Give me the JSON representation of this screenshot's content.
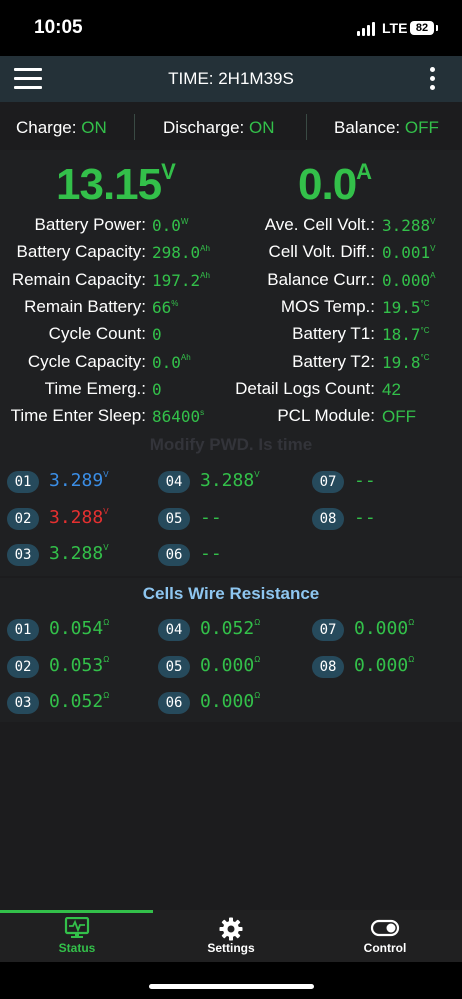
{
  "status_bar": {
    "time": "10:05",
    "network": "LTE",
    "battery": "82"
  },
  "header": {
    "title": "TIME: 2H1M39S",
    "menu_icon": "hamburger-menu-icon",
    "more_icon": "more-vertical-icon"
  },
  "toggles": [
    {
      "label": "Charge:",
      "state": "ON"
    },
    {
      "label": "Discharge:",
      "state": "ON"
    },
    {
      "label": "Balance:",
      "state": "OFF"
    }
  ],
  "summary": {
    "voltage": "13.15",
    "voltage_unit": "V",
    "current": "0.0",
    "current_unit": "A"
  },
  "left_stats": [
    {
      "label": "Battery Power:",
      "value": "0.0",
      "unit": "W"
    },
    {
      "label": "Battery Capacity:",
      "value": "298.0",
      "unit": "Ah"
    },
    {
      "label": "Remain Capacity:",
      "value": "197.2",
      "unit": "Ah"
    },
    {
      "label": "Remain Battery:",
      "value": "66",
      "unit": "%"
    },
    {
      "label": "Cycle Count:",
      "value": "0",
      "unit": ""
    },
    {
      "label": "Cycle Capacity:",
      "value": "0.0",
      "unit": "Ah"
    },
    {
      "label": "Time Emerg.:",
      "value": "0",
      "unit": ""
    },
    {
      "label": "Time Enter Sleep:",
      "value": "86400",
      "unit": "s"
    }
  ],
  "right_stats": [
    {
      "label": "Ave. Cell Volt.:",
      "value": "3.288",
      "unit": "V"
    },
    {
      "label": "Cell Volt. Diff.:",
      "value": "0.001",
      "unit": "V"
    },
    {
      "label": "Balance Curr.:",
      "value": "0.000",
      "unit": "A"
    },
    {
      "label": "MOS Temp.:",
      "value": "19.5",
      "unit": "°C"
    },
    {
      "label": "Battery T1:",
      "value": "18.7",
      "unit": "°C"
    },
    {
      "label": "Battery T2:",
      "value": "19.8",
      "unit": "°C"
    },
    {
      "label": "Detail Logs Count:",
      "value": "42",
      "unit": ""
    },
    {
      "label": "PCL Module:",
      "value": "OFF",
      "unit": ""
    }
  ],
  "cells_section": {
    "title": "Modify PWD. Is time",
    "cells": [
      {
        "id": "01",
        "value": "3.289",
        "unit": "V",
        "color": "#3b8ee6"
      },
      {
        "id": "02",
        "value": "3.288",
        "unit": "V",
        "color": "#e53030"
      },
      {
        "id": "03",
        "value": "3.288",
        "unit": "V",
        "color": "#33c04a"
      },
      {
        "id": "04",
        "value": "3.288",
        "unit": "V",
        "color": "#33c04a"
      },
      {
        "id": "05",
        "value": "--",
        "unit": "",
        "color": "#33c04a"
      },
      {
        "id": "06",
        "value": "--",
        "unit": "",
        "color": "#33c04a"
      },
      {
        "id": "07",
        "value": "--",
        "unit": "",
        "color": "#33c04a"
      },
      {
        "id": "08",
        "value": "--",
        "unit": "",
        "color": "#33c04a"
      }
    ]
  },
  "resistance_section": {
    "title": "Cells Wire Resistance",
    "cells": [
      {
        "id": "01",
        "value": "0.054",
        "unit": "Ω"
      },
      {
        "id": "02",
        "value": "0.053",
        "unit": "Ω"
      },
      {
        "id": "03",
        "value": "0.052",
        "unit": "Ω"
      },
      {
        "id": "04",
        "value": "0.052",
        "unit": "Ω"
      },
      {
        "id": "05",
        "value": "0.000",
        "unit": "Ω"
      },
      {
        "id": "06",
        "value": "0.000",
        "unit": "Ω"
      },
      {
        "id": "07",
        "value": "0.000",
        "unit": "Ω"
      },
      {
        "id": "08",
        "value": "0.000",
        "unit": "Ω"
      }
    ]
  },
  "tabs": [
    {
      "label": "Status",
      "icon": "monitor-pulse-icon",
      "active": true
    },
    {
      "label": "Settings",
      "icon": "gear-icon",
      "active": false
    },
    {
      "label": "Control",
      "icon": "toggle-icon",
      "active": false
    }
  ],
  "colors": {
    "accent": "#33c04a",
    "header": "#243138",
    "pill": "#264a5c",
    "section_title": "#8ec6f0"
  }
}
